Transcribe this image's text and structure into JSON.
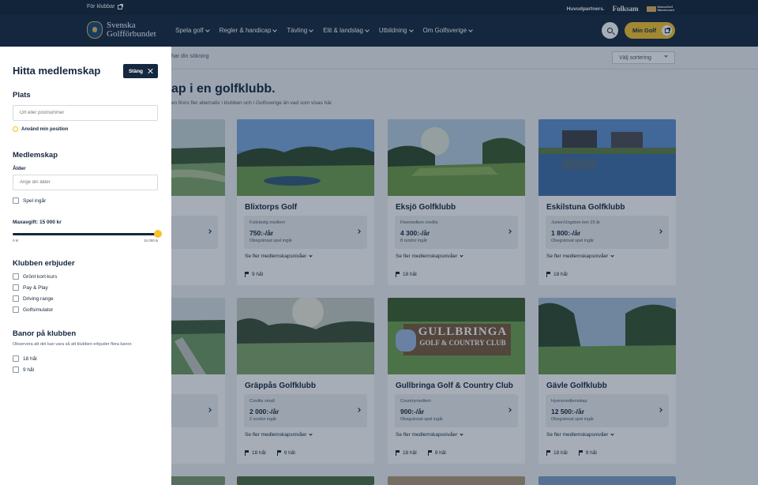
{
  "topbar": {
    "for_clubs": "För klubbar",
    "main_partners": "Huvudpartners.",
    "folksam": "Folksam",
    "mastercard_line1": "NumoGolf",
    "mastercard_line2": "Mastercard"
  },
  "header": {
    "logo_line1": "Svenska",
    "logo_line2": "Golfförbundet",
    "nav": [
      {
        "label": "Spela golf"
      },
      {
        "label": "Regler & handicap"
      },
      {
        "label": "Tävling"
      },
      {
        "label": "Elit & landslag"
      },
      {
        "label": "Utbildning"
      },
      {
        "label": "Om Golfsverige"
      }
    ],
    "min_golf": "Min Golf"
  },
  "main": {
    "search_text": "har din sökning",
    "sort_label": "Välj sortering",
    "title": "ap i en golfklubb.",
    "subtitle": "en finns fler alternativ i klubben och i Golfsverige än vad som visas här."
  },
  "clubs": [
    {
      "name": "Blixtorps Golf",
      "offer_type": "Fullvärdig medlem",
      "price": "750:-/år",
      "note": "Obegränsat spel ingår",
      "more": "Se fler medlemskapsnivåer",
      "holes": [
        "9 hål"
      ]
    },
    {
      "name": "Eksjö Golfklubb",
      "offer_type": "Flexmedlem credits",
      "price": "4 300:-/år",
      "note": "8 rundor ingår",
      "more": "Se fler medlemskapsnivåer",
      "holes": [
        "18 hål"
      ]
    },
    {
      "name": "Eskilstuna Golfklubb",
      "offer_type": "Junior/Ungdom tom 25 år",
      "price": "1 800:-/år",
      "note": "Obegränsat spel ingår",
      "more": "Se fler medlemskapsnivåer",
      "holes": [
        "18 hål"
      ]
    },
    {
      "name": "Gräppås Golfklubb",
      "offer_type": "Credits small",
      "price": "2 000:-/år",
      "note": "2 rundor ingår",
      "more": "Se fler medlemskapsnivåer",
      "holes": [
        "18 hål",
        "9 hål"
      ]
    },
    {
      "name": "Gullbringa Golf & Country Club",
      "offer_type": "Countrymedlem",
      "price": "900:-/år",
      "note": "Obegränsat spel ingår",
      "more": "Se fler medlemskapsnivåer",
      "holes": [
        "18 hål",
        "9 hål"
      ]
    },
    {
      "name": "Gävle Golfklubb",
      "offer_type": "Hyresmedlemskap",
      "price": "12 500:-/år",
      "note": "Obegränsat spel ingår",
      "more": "Se fler medlemskapsnivåer",
      "holes": [
        "18 hål",
        "9 hål"
      ]
    }
  ],
  "sign_text_1": "GULLBRINGA",
  "sign_text_2": "GOLF & COUNTRY CLUB",
  "filter": {
    "title": "Hitta medlemskap",
    "close": "Stäng",
    "place": {
      "heading": "Plats",
      "placeholder": "Ort eller postnummer",
      "use_position": "Använd min position"
    },
    "membership": {
      "heading": "Medlemskap",
      "age_label": "Ålder",
      "age_placeholder": "Ange din ålder",
      "play_included": "Spel ingår",
      "max_fee_label": "Maxavgift: 15 000 kr",
      "max_fee_fraction": 1.0,
      "slider_min": "0 kr",
      "slider_max": "15 000 kr"
    },
    "club_offers": {
      "heading": "Klubben erbjuder",
      "items": [
        "Grönt kort-kurs",
        "Pay & Play",
        "Driving range",
        "Golfsimulator"
      ]
    },
    "courses": {
      "heading": "Banor på klubben",
      "note": "Observera att det kan vara så att klubben erbjuder flera banor.",
      "items": [
        "18 hål",
        "9 hål"
      ]
    }
  }
}
